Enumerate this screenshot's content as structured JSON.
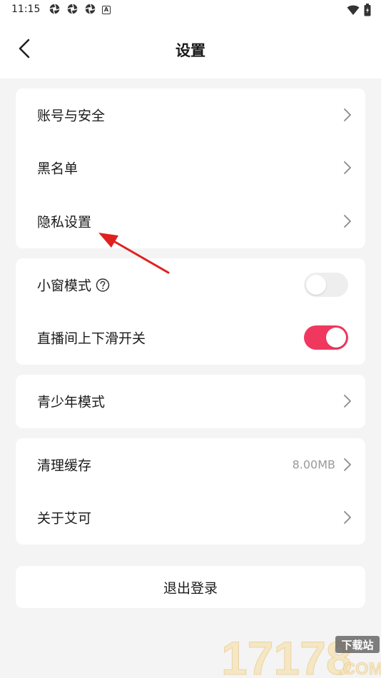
{
  "status_bar": {
    "time": "11:15",
    "badge": "A"
  },
  "header": {
    "title": "设置"
  },
  "group1": {
    "items": [
      {
        "label": "账号与安全"
      },
      {
        "label": "黑名单"
      },
      {
        "label": "隐私设置"
      }
    ]
  },
  "group2": {
    "items": [
      {
        "label": "小窗模式",
        "enabled": false
      },
      {
        "label": "直播间上下滑开关",
        "enabled": true
      }
    ]
  },
  "group3": {
    "items": [
      {
        "label": "青少年模式"
      }
    ]
  },
  "group4": {
    "items": [
      {
        "label": "清理缓存",
        "value": "8.00MB"
      },
      {
        "label": "关于艾可"
      }
    ]
  },
  "logout": {
    "label": "退出登录"
  },
  "watermark": {
    "main": "17178",
    "tag": "下载站",
    "domain": ".COM"
  },
  "colors": {
    "accent": "#f0385f",
    "annotation": "#e02020"
  }
}
